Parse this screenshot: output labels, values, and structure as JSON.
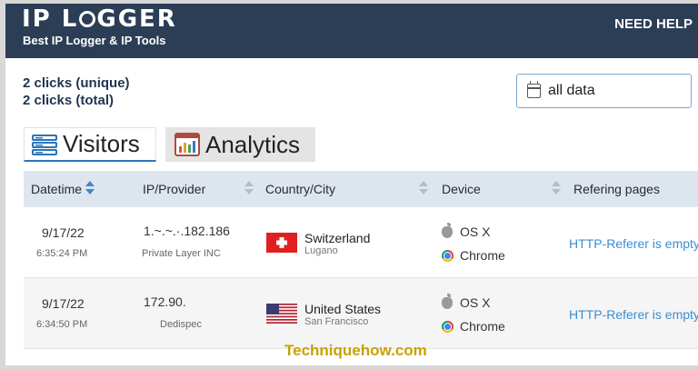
{
  "header": {
    "logo_left": "IP L",
    "logo_right": "GGER",
    "tagline": "Best IP Logger & IP Tools",
    "need_help": "NEED HELP"
  },
  "stats": {
    "unique": "2 clicks (unique)",
    "total": "2 clicks (total)"
  },
  "date_filter": {
    "value": "all data",
    "icon": "calendar-icon"
  },
  "tabs": [
    {
      "label": "Visitors",
      "icon": "visitors-list-icon",
      "active": true
    },
    {
      "label": "Analytics",
      "icon": "analytics-chart-icon",
      "active": false
    }
  ],
  "table": {
    "columns": [
      "Datetime",
      "IP/Provider",
      "Country/City",
      "Device",
      "Refering pages"
    ],
    "rows": [
      {
        "date": "9/17/22",
        "time": "6:35:24 PM",
        "ip_visible": "1.~.~.·.182.186",
        "provider": "Private Layer INC",
        "country": "Switzerland",
        "city": "Lugano",
        "flag": "switzerland-flag",
        "os": "OS X",
        "browser": "Chrome",
        "referer": "HTTP-Referer is empty"
      },
      {
        "date": "9/17/22",
        "time": "6:34:50 PM",
        "ip_visible": "172.90.",
        "provider": "Dedispec",
        "country": "United States",
        "city": "San Francisco",
        "flag": "united-states-flag",
        "os": "OS X",
        "browser": "Chrome",
        "referer": "HTTP-Referer is empty"
      }
    ]
  },
  "watermark": "Techniquehow.com",
  "colors": {
    "header_bg": "#2c3e55",
    "table_header_bg": "#dde6ef",
    "link": "#3c8dcf",
    "watermark": "#c9a000"
  }
}
